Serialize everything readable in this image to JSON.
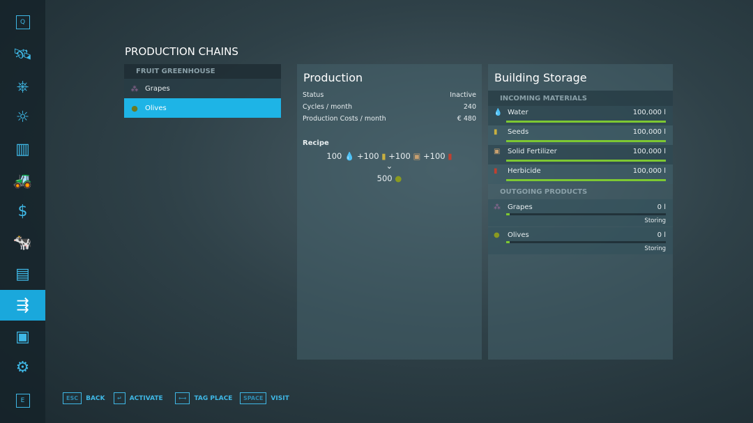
{
  "sidebar": {
    "top_key": "Q",
    "bottom_key": "E",
    "items": [
      {
        "icon": "map-icon"
      },
      {
        "icon": "steering-wheel-icon"
      },
      {
        "icon": "weather-icon"
      },
      {
        "icon": "stats-icon"
      },
      {
        "icon": "tractor-icon"
      },
      {
        "icon": "money-icon"
      },
      {
        "icon": "cow-icon"
      },
      {
        "icon": "contracts-icon"
      },
      {
        "icon": "production-icon",
        "selected": true
      },
      {
        "icon": "help-icon"
      },
      {
        "icon": "settings-icon"
      }
    ]
  },
  "title": "PRODUCTION CHAINS",
  "chains": {
    "header": "FRUIT GREENHOUSE",
    "items": [
      {
        "label": "Grapes",
        "icon": "grapes-icon"
      },
      {
        "label": "Olives",
        "icon": "olives-icon",
        "selected": true
      }
    ]
  },
  "production": {
    "title": "Production",
    "rows": [
      {
        "label": "Status",
        "value": "Inactive"
      },
      {
        "label": "Cycles / month",
        "value": "240"
      },
      {
        "label": "Production Costs / month",
        "value": "€ 480"
      }
    ],
    "recipe_label": "Recipe",
    "inputs": [
      "100",
      "+100",
      "+100",
      "+100"
    ],
    "output": "500"
  },
  "storage": {
    "title": "Building Storage",
    "incoming_header": "INCOMING MATERIALS",
    "incoming": [
      {
        "name": "Water",
        "value": "100,000 l",
        "fill": 1,
        "icon": "water-icon"
      },
      {
        "name": "Seeds",
        "value": "100,000 l",
        "fill": 1,
        "icon": "seeds-icon"
      },
      {
        "name": "Solid Fertilizer",
        "value": "100,000 l",
        "fill": 1,
        "icon": "fertilizer-icon"
      },
      {
        "name": "Herbicide",
        "value": "100,000 l",
        "fill": 1,
        "icon": "herbicide-icon"
      }
    ],
    "outgoing_header": "OUTGOING PRODUCTS",
    "outgoing": [
      {
        "name": "Grapes",
        "value": "0 l",
        "status": "Storing",
        "fill": 0.01
      },
      {
        "name": "Olives",
        "value": "0 l",
        "status": "Storing",
        "fill": 0.01
      }
    ]
  },
  "footer": [
    {
      "key": "ESC",
      "label": "BACK"
    },
    {
      "key": "↵",
      "label": "ACTIVATE"
    },
    {
      "key": "⟷",
      "label": "TAG PLACE"
    },
    {
      "key": "SPACE",
      "label": "VISIT"
    }
  ],
  "colors": {
    "accent": "#1eb4e6",
    "fill": "#7dc832"
  }
}
